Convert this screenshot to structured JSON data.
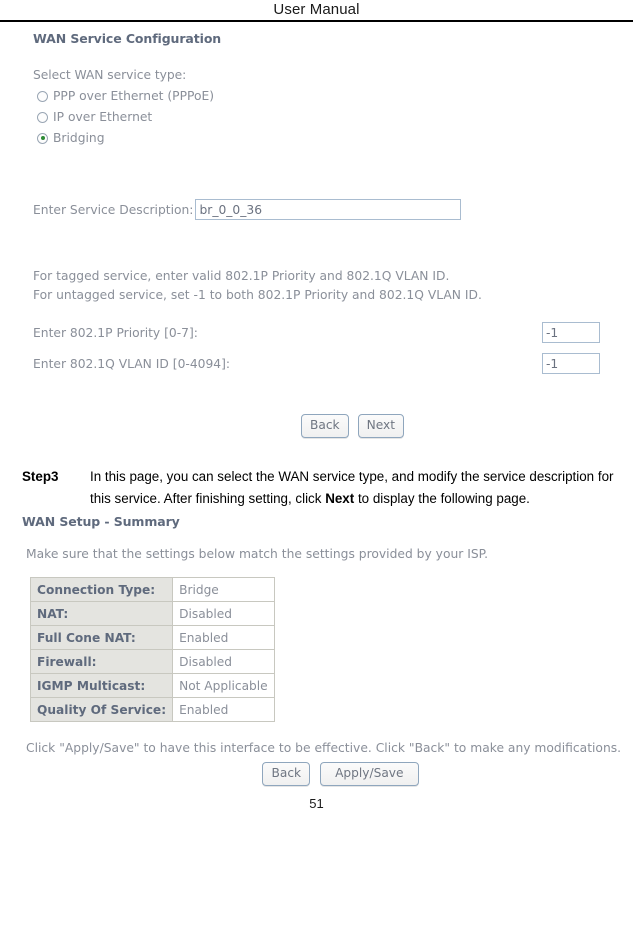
{
  "header": {
    "title": "User Manual"
  },
  "wan_service_config": {
    "title": "WAN Service Configuration",
    "select_label": "Select WAN service type:",
    "service_types": [
      {
        "label": "PPP over Ethernet (PPPoE)",
        "selected": false
      },
      {
        "label": "IP over Ethernet",
        "selected": false
      },
      {
        "label": "Bridging",
        "selected": true
      }
    ],
    "description_label": "Enter Service Description:",
    "description_value": "br_0_0_36",
    "description_placeholder": "",
    "notes": [
      "For tagged service, enter valid 802.1P Priority and 802.1Q VLAN ID.",
      "For untagged service, set -1 to both 802.1P Priority and 802.1Q VLAN ID."
    ],
    "priority_label": "Enter 802.1P Priority [0-7]:",
    "priority_value": "-1",
    "vlan_label": "Enter 802.1Q VLAN ID [0-4094]:",
    "vlan_value": "-1",
    "back_button": "Back",
    "next_button": "Next",
    "selected_radio_color": "#2e8b36"
  },
  "step": {
    "tag": "Step3",
    "text_part1": "In this page, you can select the WAN service type, and modify the service description for this service. After finishing setting, click ",
    "emphasis": "Next",
    "text_part2": " to display the following page."
  },
  "wan_setup_summary": {
    "title": "WAN Setup - Summary",
    "note": "Make sure that the settings below match the settings provided by your ISP.",
    "rows": [
      {
        "key": "Connection Type:",
        "value": "Bridge"
      },
      {
        "key": "NAT:",
        "value": "Disabled"
      },
      {
        "key": "Full Cone NAT:",
        "value": "Enabled"
      },
      {
        "key": "Firewall:",
        "value": "Disabled"
      },
      {
        "key": "IGMP Multicast:",
        "value": "Not Applicable"
      },
      {
        "key": "Quality Of Service:",
        "value": "Enabled"
      }
    ],
    "apply_note": "Click \"Apply/Save\" to have this interface to be effective. Click \"Back\" to make any modifications.",
    "back_button": "Back",
    "apply_button": "Apply/Save"
  },
  "footer": {
    "page_number": "51"
  }
}
